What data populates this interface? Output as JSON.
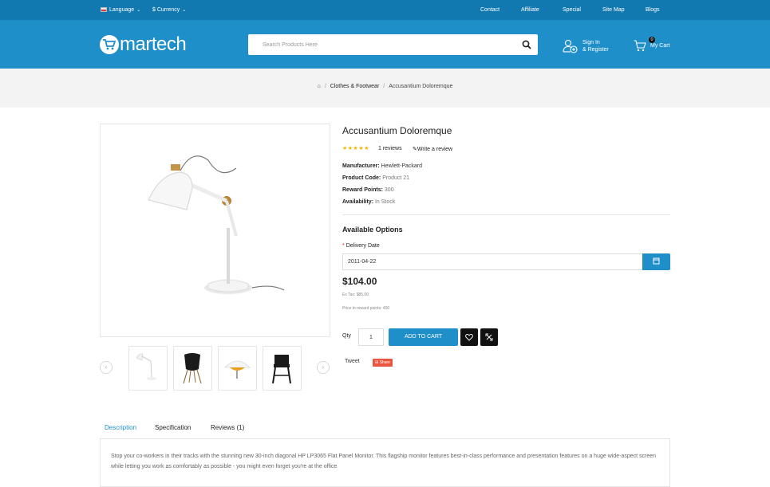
{
  "topbar": {
    "language": "Language",
    "currency": "$ Currency",
    "links": [
      "Contact",
      "Affiliate",
      "Special",
      "Site Map",
      "Blogs"
    ]
  },
  "header": {
    "logo_text": "martech",
    "search_placeholder": "Search Products Here",
    "signin_line1": "Sign In",
    "signin_line2": "& Register",
    "cart_count": "0",
    "cart_label": "My Cart"
  },
  "breadcrumb": {
    "category": "Clothes & Footwear",
    "current": "Accusantium Doloremque"
  },
  "product": {
    "title": "Accusantium Doloremque",
    "rating": 5,
    "reviews_label": "1 reviews",
    "write_review": "Write a review",
    "manufacturer_label": "Manufacturer:",
    "manufacturer": "Hewlett-Packard",
    "code_label": "Product Code:",
    "code": "Product 21",
    "reward_label": "Reward Points:",
    "reward": "300",
    "availability_label": "Availability:",
    "availability": "In Stock",
    "options_title": "Available Options",
    "delivery_label": "Delivery Date",
    "delivery_value": "2011-04-22",
    "price": "$104.00",
    "ex_tax": "Ex Tax: $85.00",
    "reward_price": "Price in reward points: 400",
    "qty_label": "Qty",
    "qty_value": "1",
    "add_to_cart": "ADD TO CART",
    "tweet": "Tweet",
    "share": "Share"
  },
  "tabs": [
    "Description",
    "Specification",
    "Reviews (1)"
  ],
  "description": "Stop your co-workers in their tracks with the stunning new 30-inch diagonal HP LP3065 Flat Panel Monitor. This flagship monitor features best-in-class performance and presentation features on a huge wide-aspect screen while letting you work as comfortably as possible - you might even forget you're at the office",
  "colors": {
    "topbar": "#1279b0",
    "header": "#1f8fca",
    "accent": "#1f8fca",
    "stars": "#f5b400",
    "share": "#e8563f"
  }
}
